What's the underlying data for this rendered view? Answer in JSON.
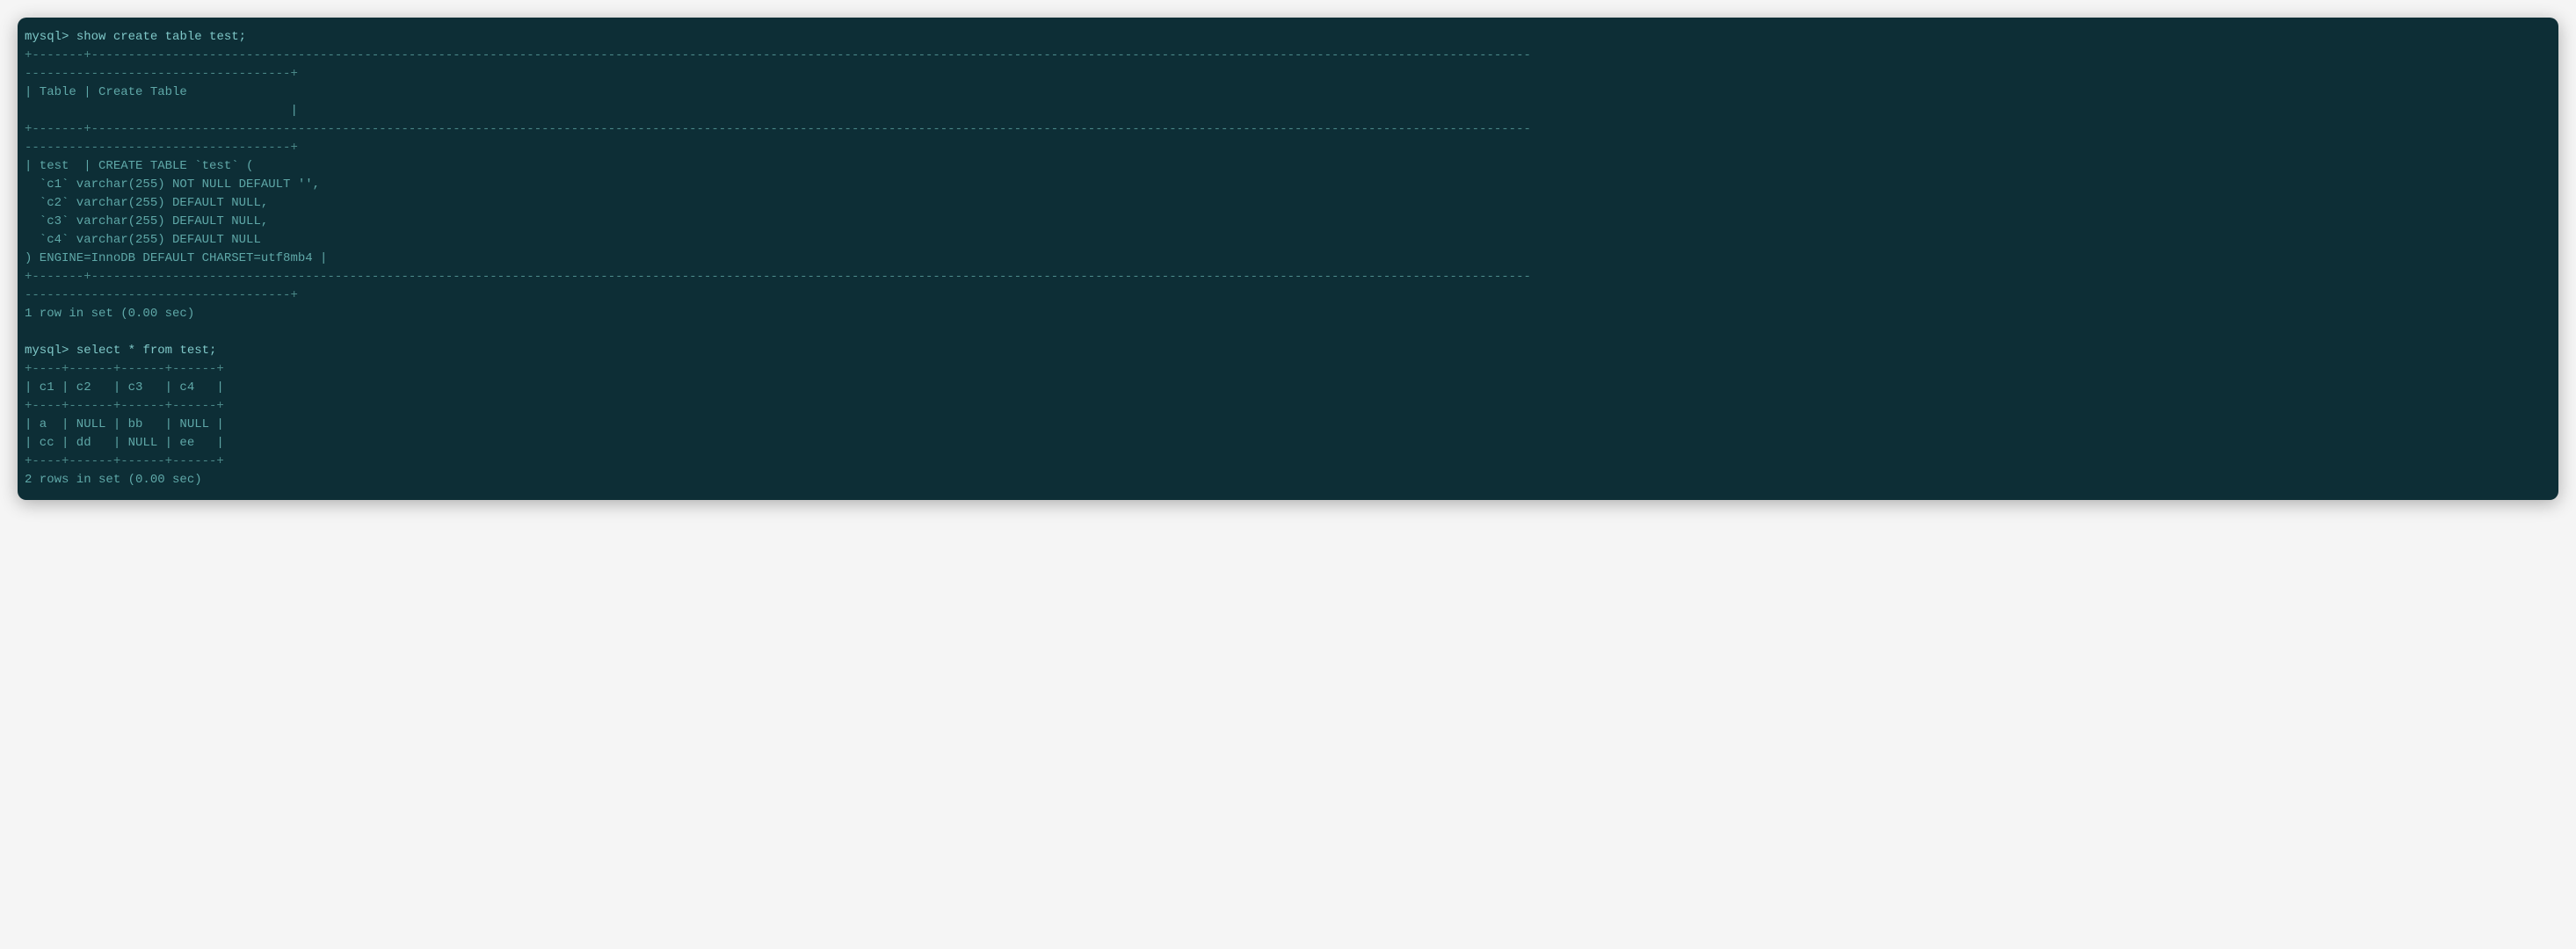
{
  "terminal": {
    "prompt1": "mysql>",
    "command1": "show create table test;",
    "sep1_line1": "+-------+---------------------------------------------------------------------------------------------------------------------------------------------------------------------------------------------------",
    "sep1_line2": "------------------------------------+",
    "header_line1": "| Table | Create Table",
    "header_line2": "                                    |",
    "body_line1": "| test  | CREATE TABLE `test` (",
    "body_line2": "  `c1` varchar(255) NOT NULL DEFAULT '',",
    "body_line3": "  `c2` varchar(255) DEFAULT NULL,",
    "body_line4": "  `c3` varchar(255) DEFAULT NULL,",
    "body_line5": "  `c4` varchar(255) DEFAULT NULL",
    "body_line6": ") ENGINE=InnoDB DEFAULT CHARSET=utf8mb4 |",
    "result1": "1 row in set (0.00 sec)",
    "blank": "",
    "prompt2": "mysql>",
    "command2": "select * from test;",
    "sep2": "+----+------+------+------+",
    "header2": "| c1 | c2   | c3   | c4   |",
    "row1": "| a  | NULL | bb   | NULL |",
    "row2": "| cc | dd   | NULL | ee   |",
    "result2": "2 rows in set (0.00 sec)"
  }
}
